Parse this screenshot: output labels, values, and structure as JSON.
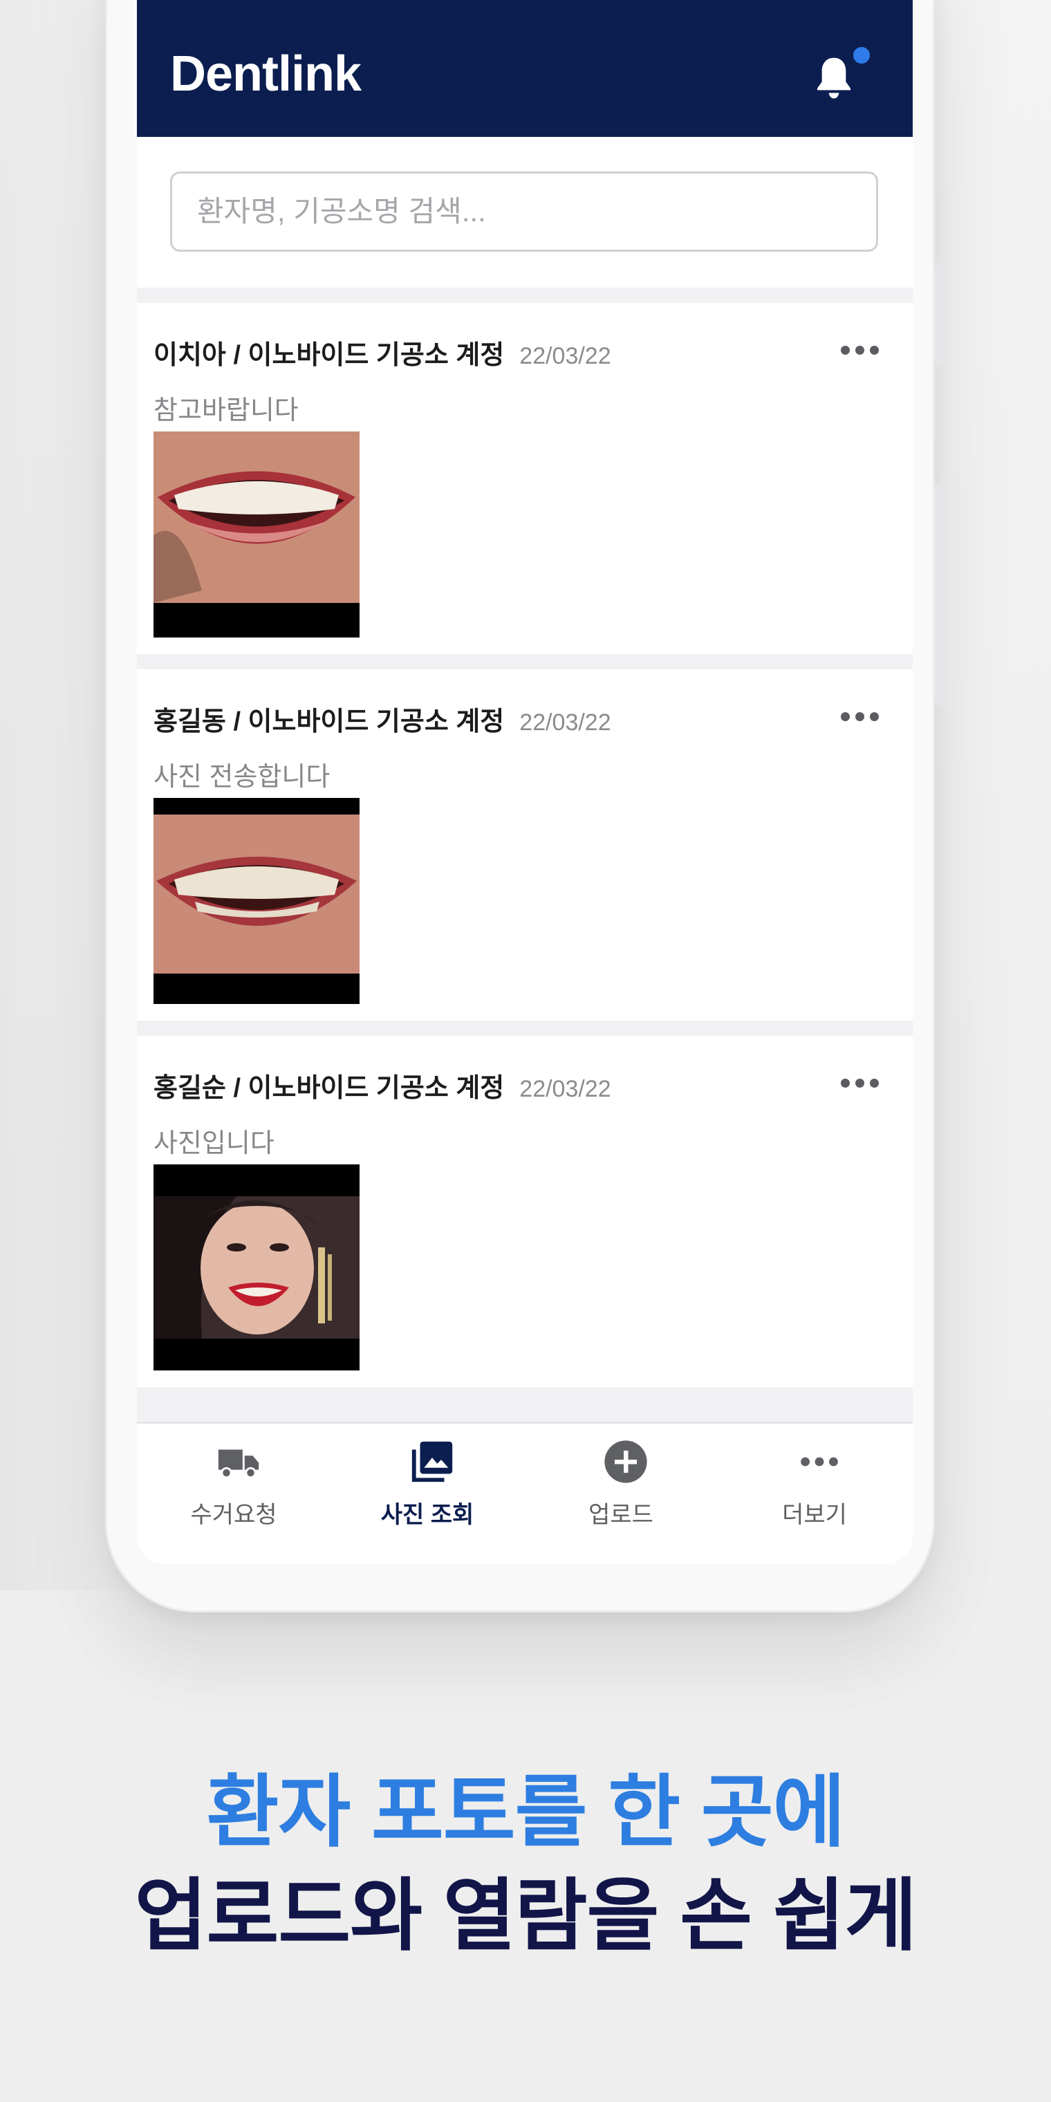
{
  "app": {
    "title": "Dentlink",
    "has_notification": true
  },
  "search": {
    "placeholder": "환자명, 기공소명 검색...",
    "value": ""
  },
  "posts": [
    {
      "author": "이치아 / 이노바이드 기공소 계정",
      "date": "22/03/22",
      "message": "참고바랍니다"
    },
    {
      "author": "홍길동 / 이노바이드 기공소 계정",
      "date": "22/03/22",
      "message": "사진 전송합니다"
    },
    {
      "author": "홍길순 / 이노바이드 기공소 계정",
      "date": "22/03/22",
      "message": "사진입니다"
    }
  ],
  "nav": {
    "items": [
      {
        "label": "수거요청",
        "icon": "truck-icon"
      },
      {
        "label": "사진 조회",
        "icon": "photo-icon",
        "active": true
      },
      {
        "label": "업로드",
        "icon": "plus-circle-icon"
      },
      {
        "label": "더보기",
        "icon": "more-icon"
      }
    ]
  },
  "promo": {
    "line1": "환자 포토를 한 곳에",
    "line2": "업로드와 열람을 손 쉽게"
  },
  "colors": {
    "header": "#0b1e4f",
    "accent_dot": "#2f7bea",
    "promo_blue": "#2d7ee0",
    "promo_navy": "#111548"
  }
}
